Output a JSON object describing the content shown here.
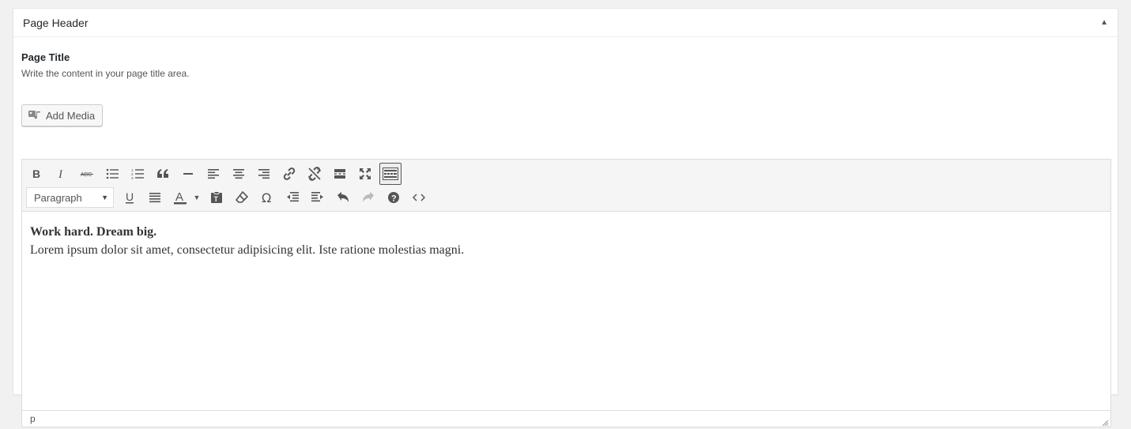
{
  "metabox": {
    "title": "Page Header",
    "toggle_label": "▲"
  },
  "field": {
    "label": "Page Title",
    "description": "Write the content in your page title area."
  },
  "media": {
    "add_media_label": "Add Media"
  },
  "toolbar": {
    "format_select": "Paragraph",
    "row1_icons": [
      "bold-icon",
      "italic-icon",
      "strikethrough-icon",
      "bullet-list-icon",
      "numbered-list-icon",
      "blockquote-icon",
      "horizontal-line-icon",
      "align-left-icon",
      "align-center-icon",
      "align-right-icon",
      "insert-link-icon",
      "remove-link-icon",
      "read-more-icon",
      "fullscreen-icon",
      "toolbar-toggle-icon"
    ],
    "row2_icons": [
      "underline-icon",
      "justify-icon",
      "text-color-icon",
      "paste-as-text-icon",
      "clear-formatting-icon",
      "special-character-icon",
      "outdent-icon",
      "indent-icon",
      "undo-icon",
      "redo-icon",
      "help-icon",
      "code-icon"
    ]
  },
  "content": {
    "heading": "Work hard. Dream big.",
    "paragraph": "Lorem ipsum dolor sit amet, consectetur adipisicing elit. Iste ratione molestias magni."
  },
  "statusbar": {
    "path": "p"
  }
}
